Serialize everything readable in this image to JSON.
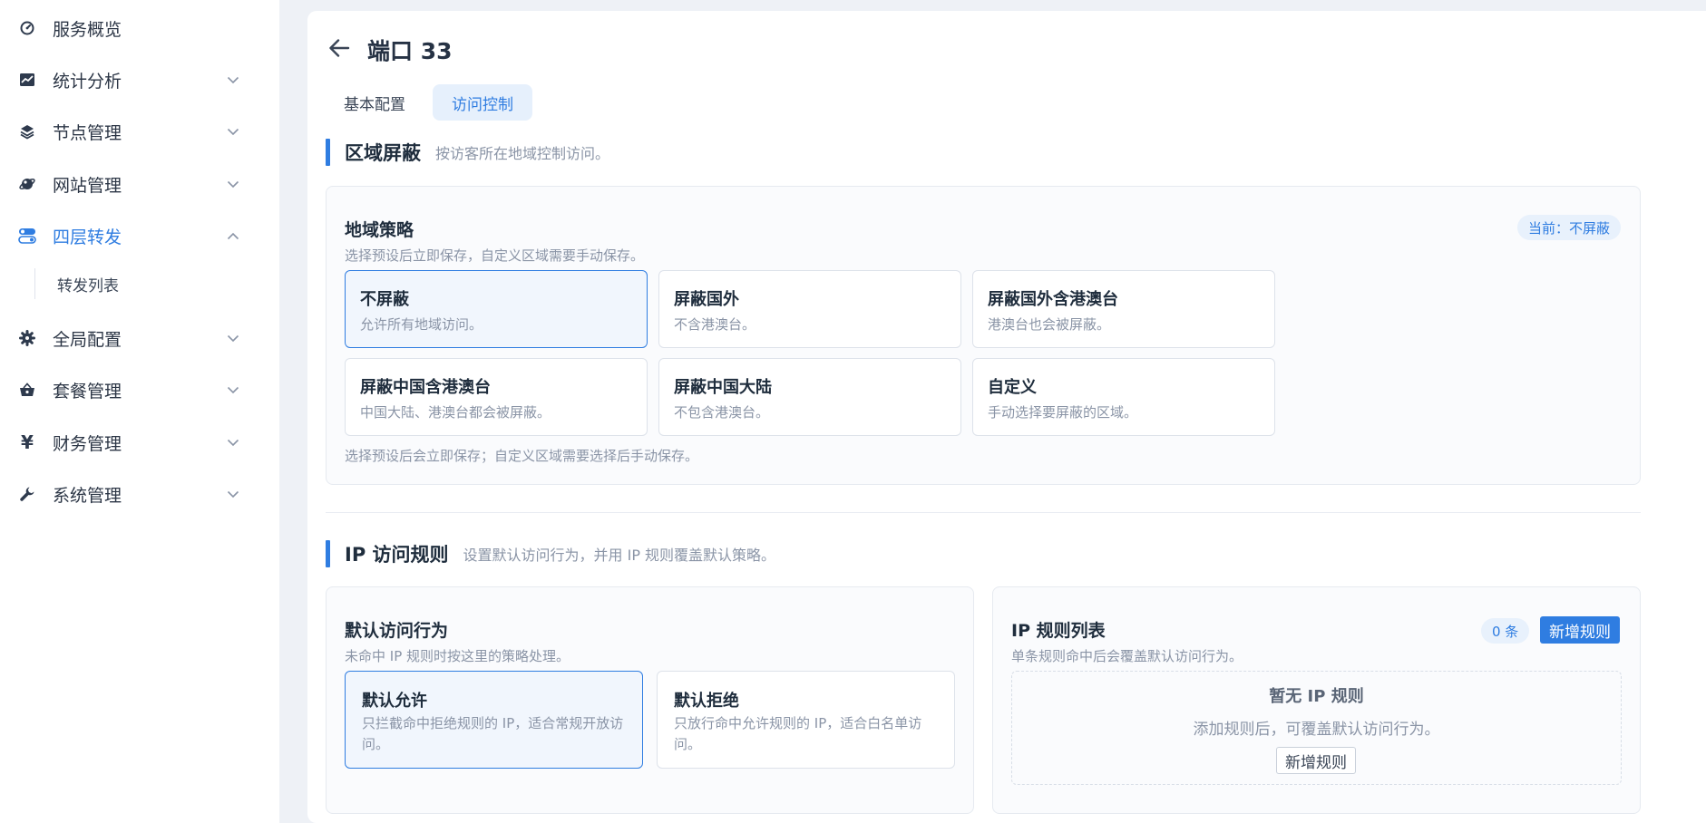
{
  "sidebar": {
    "items": [
      {
        "label": "服务概览",
        "icon": "dashboard-icon"
      },
      {
        "label": "统计分析",
        "icon": "chart-icon"
      },
      {
        "label": "节点管理",
        "icon": "layers-icon"
      },
      {
        "label": "网站管理",
        "icon": "globe-icon"
      },
      {
        "label": "四层转发",
        "icon": "toggle-icon"
      },
      {
        "label": "全局配置",
        "icon": "gear-icon"
      },
      {
        "label": "套餐管理",
        "icon": "basket-icon"
      },
      {
        "label": "财务管理",
        "icon": "yen-icon"
      },
      {
        "label": "系统管理",
        "icon": "wrench-icon"
      }
    ],
    "sub_item": "转发列表",
    "yen_glyph": "¥"
  },
  "header": {
    "title": "端口 33"
  },
  "tabs": [
    {
      "label": "基本配置"
    },
    {
      "label": "访问控制"
    }
  ],
  "region": {
    "title": "区域屏蔽",
    "desc": "按访客所在地域控制访问。",
    "card_title": "地域策略",
    "card_sub": "选择预设后立即保存，自定义区域需要手动保存。",
    "current_badge": "当前：不屏蔽",
    "options": [
      {
        "title": "不屏蔽",
        "desc": "允许所有地域访问。"
      },
      {
        "title": "屏蔽国外",
        "desc": "不含港澳台。"
      },
      {
        "title": "屏蔽国外含港澳台",
        "desc": "港澳台也会被屏蔽。"
      },
      {
        "title": "屏蔽中国含港澳台",
        "desc": "中国大陆、港澳台都会被屏蔽。"
      },
      {
        "title": "屏蔽中国大陆",
        "desc": "不包含港澳台。"
      },
      {
        "title": "自定义",
        "desc": "手动选择要屏蔽的区域。"
      }
    ],
    "note": "选择预设后会立即保存；自定义区域需要选择后手动保存。"
  },
  "ip": {
    "title": "IP 访问规则",
    "desc": "设置默认访问行为，并用 IP 规则覆盖默认策略。",
    "default_card": {
      "title": "默认访问行为",
      "sub": "未命中 IP 规则时按这里的策略处理。",
      "options": [
        {
          "title": "默认允许",
          "desc": "只拦截命中拒绝规则的 IP，适合常规开放访问。"
        },
        {
          "title": "默认拒绝",
          "desc": "只放行命中允许规则的 IP，适合白名单访问。"
        }
      ]
    },
    "rules_card": {
      "title": "IP 规则列表",
      "sub": "单条规则命中后会覆盖默认访问行为。",
      "count_badge": "0 条",
      "add_button": "新增规则",
      "empty_title": "暂无 IP 规则",
      "empty_desc": "添加规则后，可覆盖默认访问行为。",
      "empty_button": "新增规则"
    }
  },
  "colors": {
    "accent": "#2f7de1",
    "background": "#eef1f6"
  }
}
